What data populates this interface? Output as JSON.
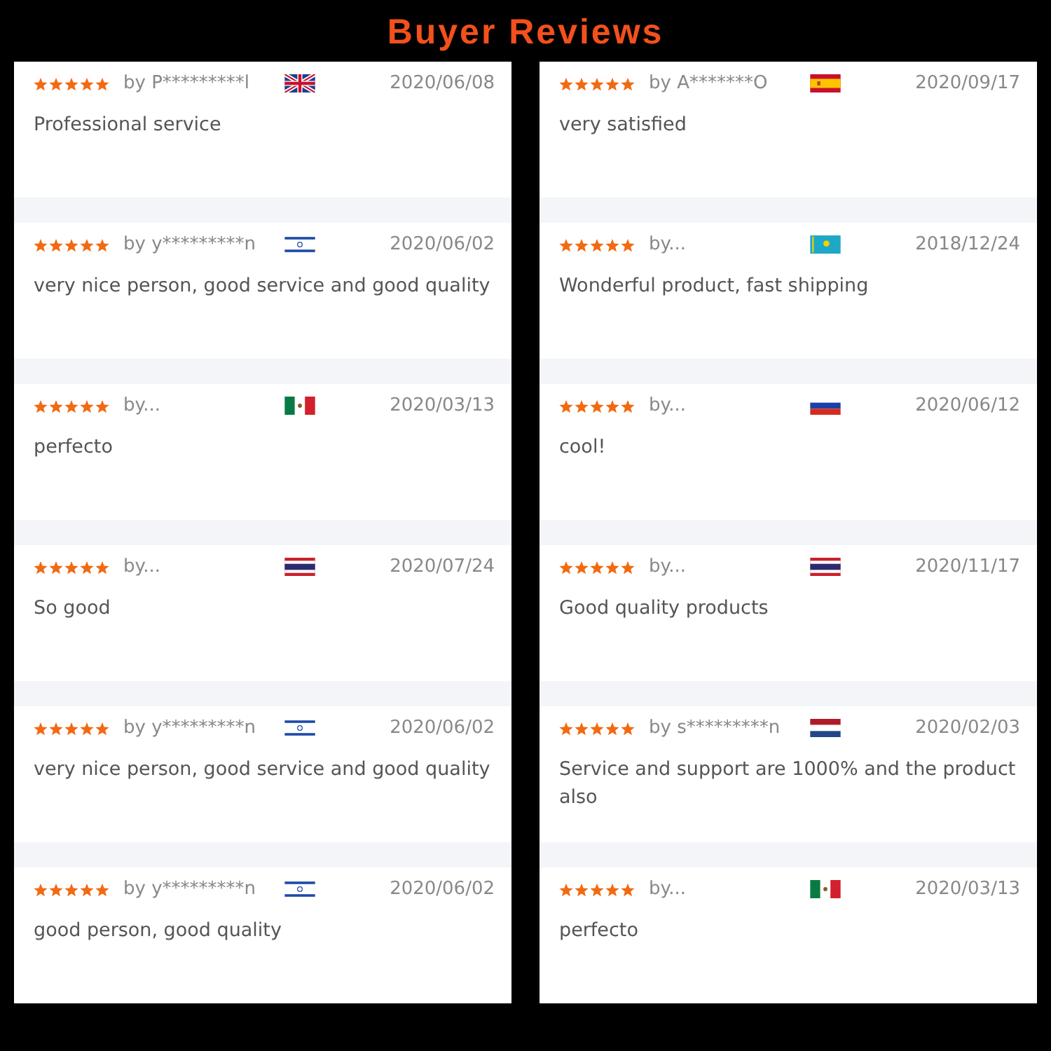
{
  "title": "Buyer Reviews",
  "columns": [
    {
      "reviews": [
        {
          "stars": 5,
          "author": "by P*********l",
          "flag": {
            "kind": "gb"
          },
          "date": "2020/06/08",
          "text": "Professional service"
        },
        {
          "stars": 5,
          "author": "by y*********n",
          "flag": {
            "kind": "il"
          },
          "date": "2020/06/02",
          "text": "very nice person, good service and good quality"
        },
        {
          "stars": 5,
          "author": "by...",
          "flag": {
            "kind": "mx"
          },
          "date": "2020/03/13",
          "text": "perfecto"
        },
        {
          "stars": 5,
          "author": "by...",
          "flag": {
            "kind": "th"
          },
          "date": "2020/07/24",
          "text": "So good"
        },
        {
          "stars": 5,
          "author": "by y*********n",
          "flag": {
            "kind": "il"
          },
          "date": "2020/06/02",
          "text": "very nice person, good service and good quality"
        },
        {
          "stars": 5,
          "author": "by y*********n",
          "flag": {
            "kind": "il"
          },
          "date": "2020/06/02",
          "text": "good person, good quality"
        }
      ]
    },
    {
      "reviews": [
        {
          "stars": 5,
          "author": "by A*******O",
          "flag": {
            "kind": "es"
          },
          "date": "2020/09/17",
          "text": "very satisfied"
        },
        {
          "stars": 5,
          "author": "by...",
          "flag": {
            "kind": "kz"
          },
          "date": "2018/12/24",
          "text": "Wonderful product, fast shipping"
        },
        {
          "stars": 5,
          "author": "by...",
          "flag": {
            "kind": "ru"
          },
          "date": "2020/06/12",
          "text": "cool!"
        },
        {
          "stars": 5,
          "author": "by...",
          "flag": {
            "kind": "th"
          },
          "date": "2020/11/17",
          "text": "Good quality products"
        },
        {
          "stars": 5,
          "author": "by s*********n",
          "flag": {
            "kind": "nl"
          },
          "date": "2020/02/03",
          "text": "Service and support are 1000% and the product also"
        },
        {
          "stars": 5,
          "author": "by...",
          "flag": {
            "kind": "mx"
          },
          "date": "2020/03/13",
          "text": "perfecto"
        }
      ]
    }
  ]
}
